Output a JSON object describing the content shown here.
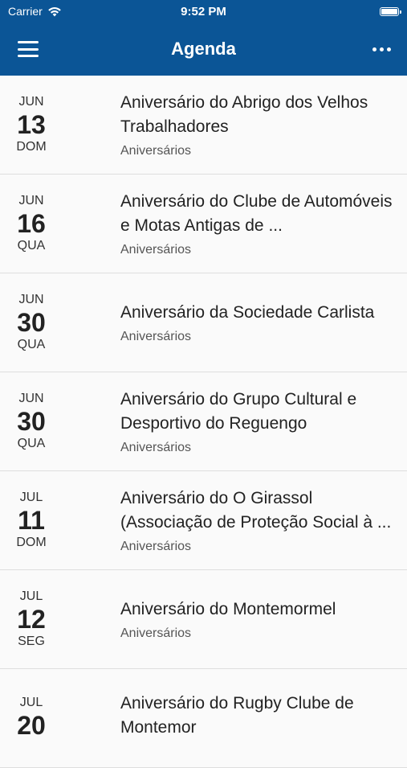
{
  "status": {
    "carrier": "Carrier",
    "time": "9:52 PM",
    "battery_level": 1.0
  },
  "header": {
    "title": "Agenda"
  },
  "events": [
    {
      "month": "JUN",
      "day": "13",
      "weekday": "DOM",
      "title": "Aniversário do Abrigo dos Velhos Trabalhadores",
      "category": "Aniversários"
    },
    {
      "month": "JUN",
      "day": "16",
      "weekday": "QUA",
      "title": "Aniversário do Clube de Automóveis e Motas Antigas de ...",
      "category": "Aniversários"
    },
    {
      "month": "JUN",
      "day": "30",
      "weekday": "QUA",
      "title": "Aniversário da Sociedade Carlista",
      "category": "Aniversários"
    },
    {
      "month": "JUN",
      "day": "30",
      "weekday": "QUA",
      "title": "Aniversário do Grupo Cultural e Desportivo do Reguengo",
      "category": "Aniversários"
    },
    {
      "month": "JUL",
      "day": "11",
      "weekday": "DOM",
      "title": "Aniversário do O Girassol (Associação de Proteção Social à ...",
      "category": "Aniversários"
    },
    {
      "month": "JUL",
      "day": "12",
      "weekday": "SEG",
      "title": "Aniversário do Montemormel",
      "category": "Aniversários"
    },
    {
      "month": "JUL",
      "day": "20",
      "weekday": "",
      "title": "Aniversário do Rugby Clube de Montemor",
      "category": ""
    }
  ]
}
